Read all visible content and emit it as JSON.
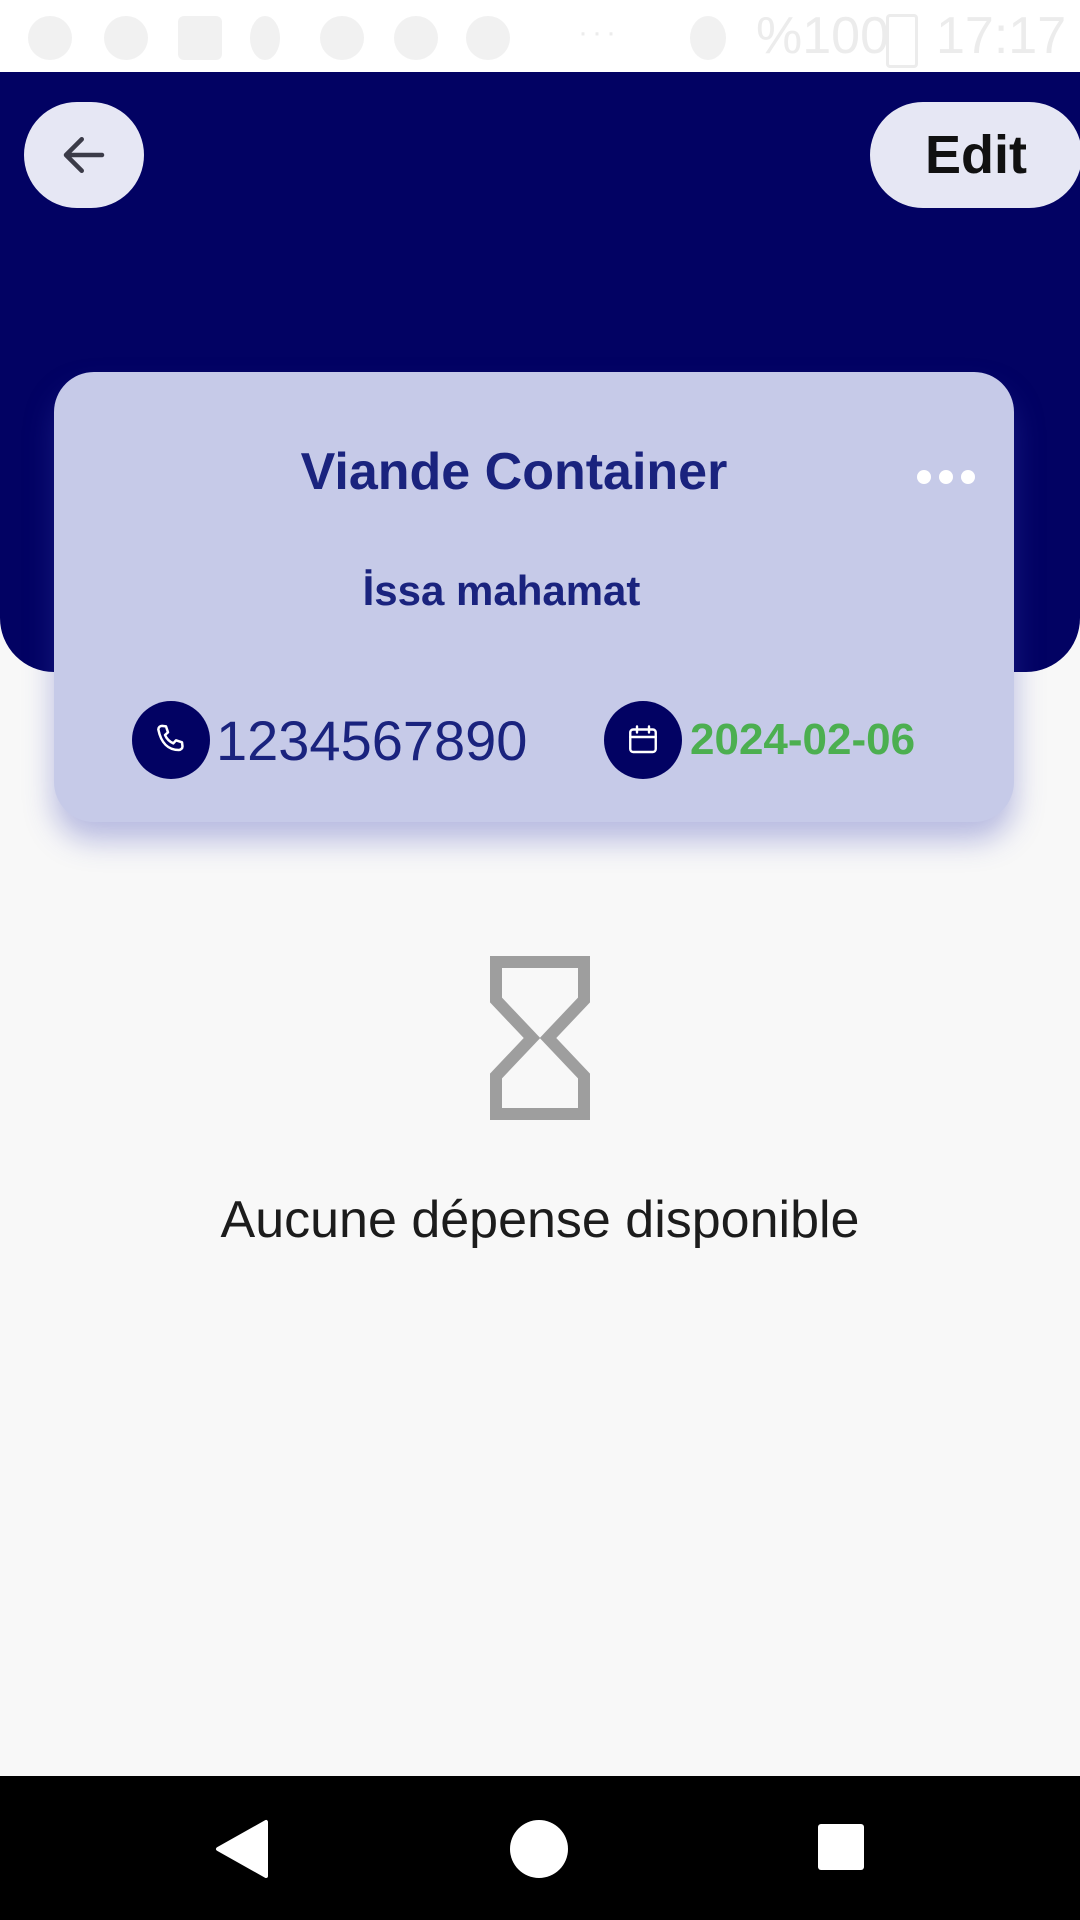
{
  "status_bar": {
    "battery": "%100",
    "time": "17:17"
  },
  "header": {
    "back_icon": "arrow-left-icon",
    "edit_label": "Edit"
  },
  "card": {
    "title": "Viande Container",
    "more_icon": "more-horizontal-icon",
    "subtitle": "İssa mahamat",
    "phone_icon": "phone-icon",
    "phone": "1234567890",
    "date_icon": "calendar-icon",
    "date": "2024-02-06",
    "date_color": "#4caf50"
  },
  "empty_state": {
    "icon": "hourglass-icon",
    "message": "Aucune dépense disponible"
  },
  "colors": {
    "header_bg": "#020263",
    "card_bg": "#c6cae8",
    "text_primary": "#1a237e"
  },
  "nav_bar": {
    "back_icon": "nav-back-icon",
    "home_icon": "nav-home-icon",
    "recents_icon": "nav-recents-icon"
  }
}
